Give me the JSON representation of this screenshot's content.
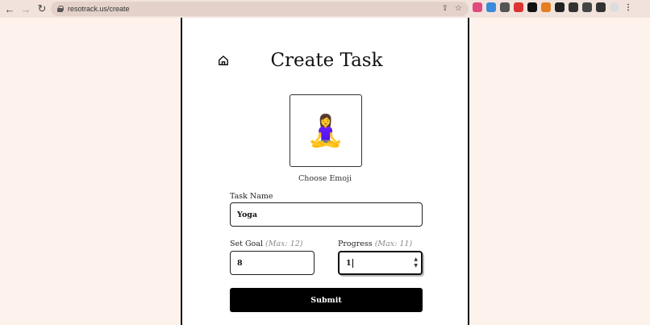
{
  "browser": {
    "url": "resotrack.us/create"
  },
  "page": {
    "title": "Create Task",
    "choose_emoji_label": "Choose Emoji",
    "selected_emoji": "🧘‍♀️"
  },
  "form": {
    "task_name": {
      "label": "Task Name",
      "value": "Yoga"
    },
    "set_goal": {
      "label": "Set Goal",
      "hint": "(Max: 12)",
      "value": "8"
    },
    "progress": {
      "label": "Progress",
      "hint": "(Max: 11)",
      "value": "1"
    },
    "submit_label": "Submit"
  },
  "colors": {
    "background": "#fdf3ec",
    "panel": "#ffffff",
    "button": "#000000"
  }
}
